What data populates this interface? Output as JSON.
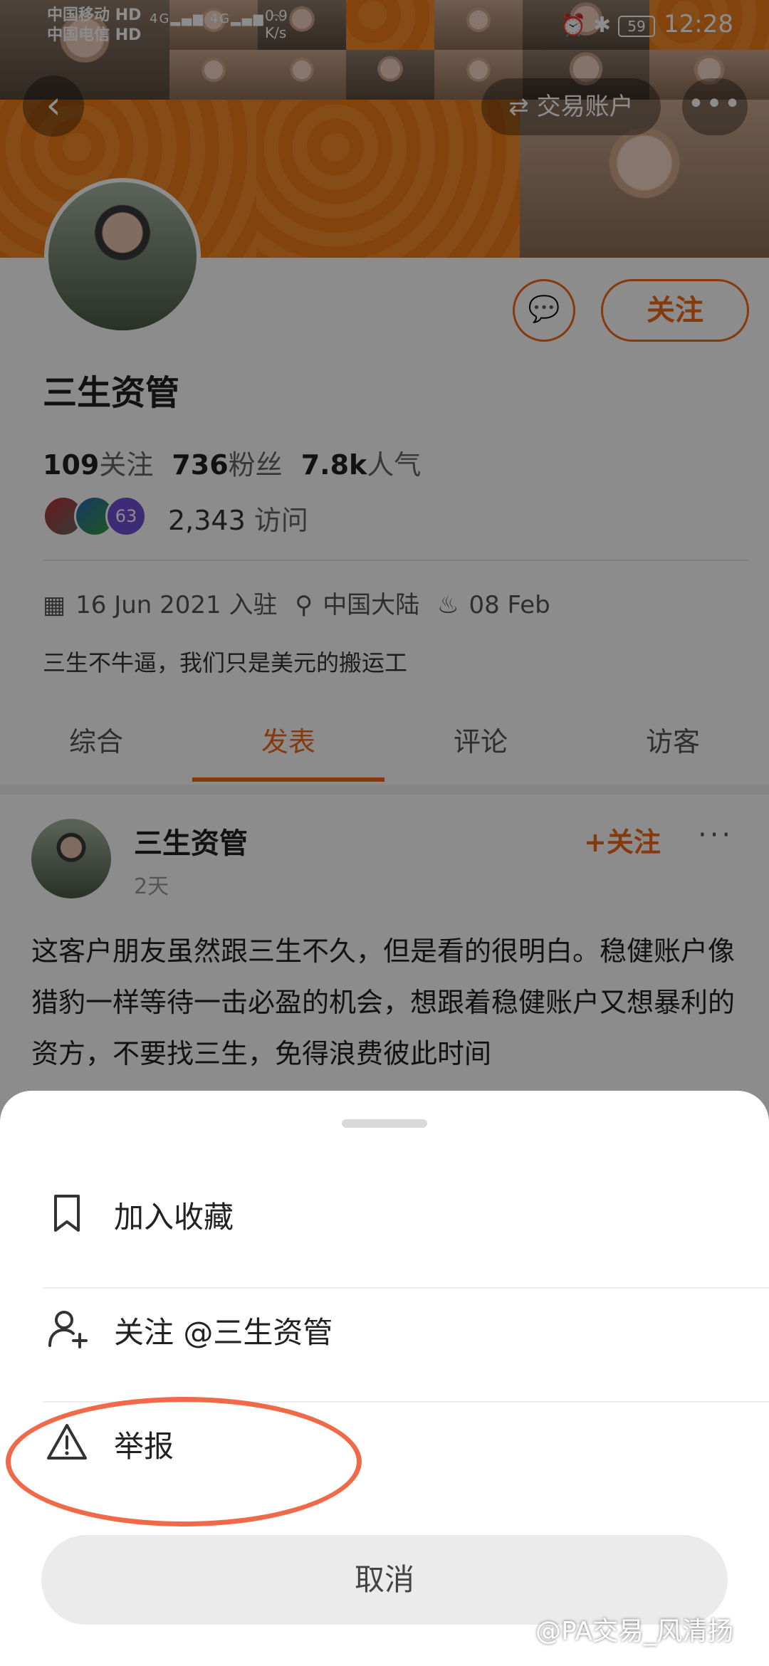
{
  "status_bar": {
    "carrier1": "中国移动",
    "carrier1_badge": "HD",
    "carrier2": "中国电信",
    "carrier2_badge": "HD",
    "network": "4G",
    "speed_value": "0.9",
    "speed_unit": "K/s",
    "battery": "59",
    "time": "12:28"
  },
  "header": {
    "back_icon": "chevron-left-icon",
    "switch_account_label": "⇄ 交易账户",
    "more_icon": "more-icon"
  },
  "profile": {
    "name": "三生资管",
    "follow_label": "关注",
    "stats": {
      "following_count": "109",
      "following_label": "关注",
      "fans_count": "736",
      "fans_label": "粉丝",
      "popularity_count": "7.8k",
      "popularity_label": "人气"
    },
    "visitors_badge": "63",
    "visits_count": "2,343",
    "visits_label": "访问",
    "joined": "16 Jun 2021 入驻",
    "location": "中国大陆",
    "birthday": "08 Feb",
    "bio": "三生不牛逼，我们只是美元的搬运工"
  },
  "tabs": [
    "综合",
    "发表",
    "评论",
    "访客"
  ],
  "active_tab": "发表",
  "post": {
    "author": "三生资管",
    "time": "2天",
    "follow_label": "+关注",
    "more": "···",
    "text": "这客户朋友虽然跟三生不久，但是看的很明白。稳健账户像猎豹一样等待一击必盈的机会，想跟着稳健账户又想暴利的资方，不要找三生，免得浪费彼此时间"
  },
  "sheet": {
    "options": [
      {
        "icon": "bookmark-icon",
        "label": "加入收藏"
      },
      {
        "icon": "add-user-icon",
        "label": "关注 @三生资管"
      },
      {
        "icon": "warning-icon",
        "label": "举报"
      }
    ],
    "cancel_label": "取消"
  },
  "watermark": "@PA交易_风清扬",
  "colors": {
    "accent": "#f26a1b",
    "banner": "#f07a1c",
    "annotation": "#f06a4a"
  }
}
